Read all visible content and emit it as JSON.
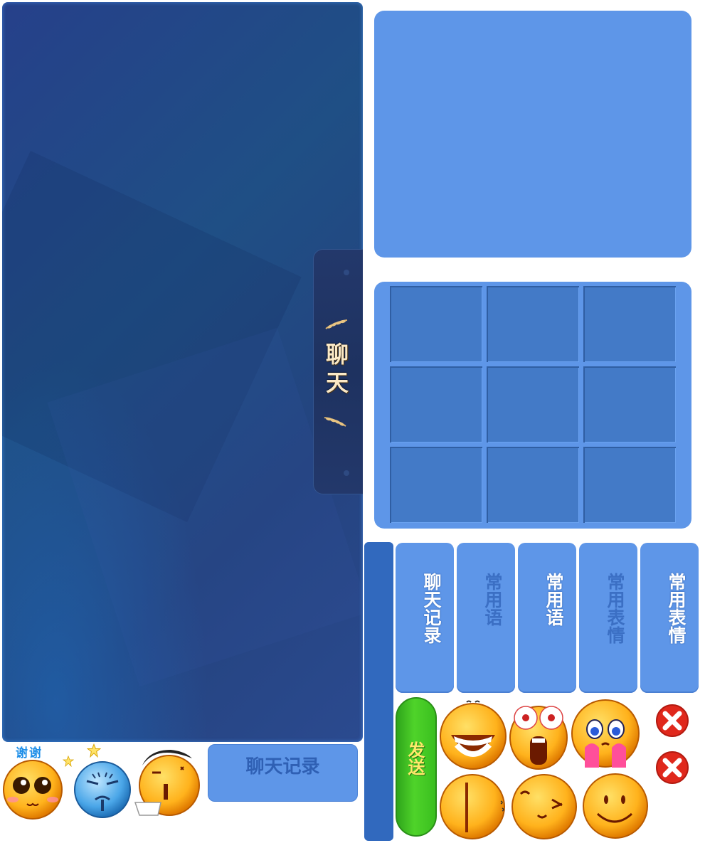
{
  "chat_tab": {
    "label": "聊天"
  },
  "tabs": [
    {
      "label": "聊天记录",
      "state": "active"
    },
    {
      "label": "常用语",
      "state": "dim"
    },
    {
      "label": "常用语",
      "state": "active"
    },
    {
      "label": "常用表情",
      "state": "dim"
    },
    {
      "label": "常用表情",
      "state": "active"
    }
  ],
  "send_button": {
    "label": "发送"
  },
  "record_button": {
    "label": "聊天记录"
  },
  "thanks_emoticon": {
    "text": "谢谢"
  },
  "grid": {
    "rows": 3,
    "cols": 3
  },
  "colors": {
    "panel_blue": "#5e96e8",
    "cell_blue": "#437ac7",
    "bar_blue": "#3169be",
    "send_green": "#3abf1f",
    "chat_bg": "#24437f"
  },
  "emoticons": [
    "grin-icon",
    "shocked-eyes-icon",
    "crying-hug-icon",
    "close-icon",
    "thanks-icon",
    "sweat-blue-icon",
    "tongue-icon",
    "sleepy-icon",
    "speechless-icon",
    "smile-icon",
    "close-icon"
  ]
}
